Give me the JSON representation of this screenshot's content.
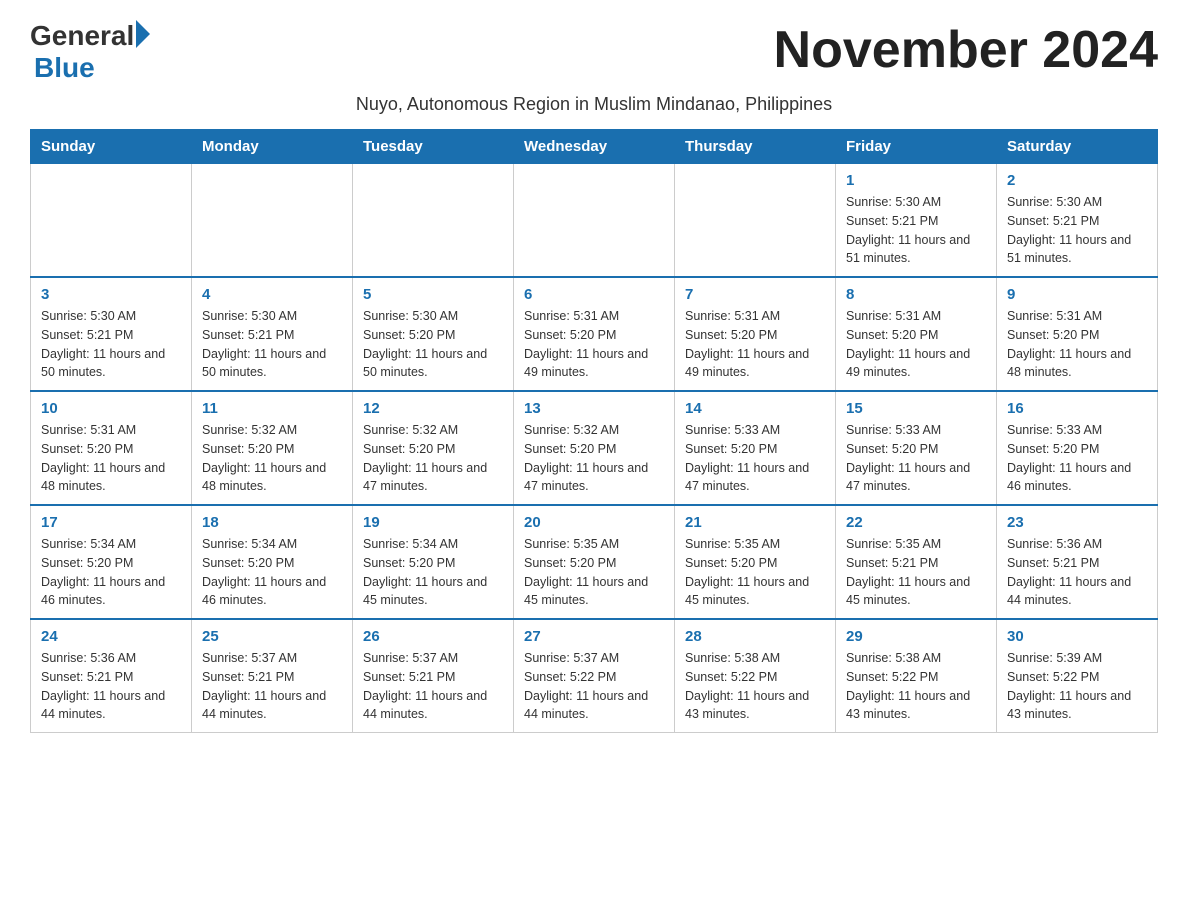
{
  "logo": {
    "general": "General",
    "blue": "Blue"
  },
  "title": "November 2024",
  "subtitle": "Nuyo, Autonomous Region in Muslim Mindanao, Philippines",
  "headers": [
    "Sunday",
    "Monday",
    "Tuesday",
    "Wednesday",
    "Thursday",
    "Friday",
    "Saturday"
  ],
  "weeks": [
    [
      {
        "day": "",
        "info": ""
      },
      {
        "day": "",
        "info": ""
      },
      {
        "day": "",
        "info": ""
      },
      {
        "day": "",
        "info": ""
      },
      {
        "day": "",
        "info": ""
      },
      {
        "day": "1",
        "info": "Sunrise: 5:30 AM\nSunset: 5:21 PM\nDaylight: 11 hours and 51 minutes."
      },
      {
        "day": "2",
        "info": "Sunrise: 5:30 AM\nSunset: 5:21 PM\nDaylight: 11 hours and 51 minutes."
      }
    ],
    [
      {
        "day": "3",
        "info": "Sunrise: 5:30 AM\nSunset: 5:21 PM\nDaylight: 11 hours and 50 minutes."
      },
      {
        "day": "4",
        "info": "Sunrise: 5:30 AM\nSunset: 5:21 PM\nDaylight: 11 hours and 50 minutes."
      },
      {
        "day": "5",
        "info": "Sunrise: 5:30 AM\nSunset: 5:20 PM\nDaylight: 11 hours and 50 minutes."
      },
      {
        "day": "6",
        "info": "Sunrise: 5:31 AM\nSunset: 5:20 PM\nDaylight: 11 hours and 49 minutes."
      },
      {
        "day": "7",
        "info": "Sunrise: 5:31 AM\nSunset: 5:20 PM\nDaylight: 11 hours and 49 minutes."
      },
      {
        "day": "8",
        "info": "Sunrise: 5:31 AM\nSunset: 5:20 PM\nDaylight: 11 hours and 49 minutes."
      },
      {
        "day": "9",
        "info": "Sunrise: 5:31 AM\nSunset: 5:20 PM\nDaylight: 11 hours and 48 minutes."
      }
    ],
    [
      {
        "day": "10",
        "info": "Sunrise: 5:31 AM\nSunset: 5:20 PM\nDaylight: 11 hours and 48 minutes."
      },
      {
        "day": "11",
        "info": "Sunrise: 5:32 AM\nSunset: 5:20 PM\nDaylight: 11 hours and 48 minutes."
      },
      {
        "day": "12",
        "info": "Sunrise: 5:32 AM\nSunset: 5:20 PM\nDaylight: 11 hours and 47 minutes."
      },
      {
        "day": "13",
        "info": "Sunrise: 5:32 AM\nSunset: 5:20 PM\nDaylight: 11 hours and 47 minutes."
      },
      {
        "day": "14",
        "info": "Sunrise: 5:33 AM\nSunset: 5:20 PM\nDaylight: 11 hours and 47 minutes."
      },
      {
        "day": "15",
        "info": "Sunrise: 5:33 AM\nSunset: 5:20 PM\nDaylight: 11 hours and 47 minutes."
      },
      {
        "day": "16",
        "info": "Sunrise: 5:33 AM\nSunset: 5:20 PM\nDaylight: 11 hours and 46 minutes."
      }
    ],
    [
      {
        "day": "17",
        "info": "Sunrise: 5:34 AM\nSunset: 5:20 PM\nDaylight: 11 hours and 46 minutes."
      },
      {
        "day": "18",
        "info": "Sunrise: 5:34 AM\nSunset: 5:20 PM\nDaylight: 11 hours and 46 minutes."
      },
      {
        "day": "19",
        "info": "Sunrise: 5:34 AM\nSunset: 5:20 PM\nDaylight: 11 hours and 45 minutes."
      },
      {
        "day": "20",
        "info": "Sunrise: 5:35 AM\nSunset: 5:20 PM\nDaylight: 11 hours and 45 minutes."
      },
      {
        "day": "21",
        "info": "Sunrise: 5:35 AM\nSunset: 5:20 PM\nDaylight: 11 hours and 45 minutes."
      },
      {
        "day": "22",
        "info": "Sunrise: 5:35 AM\nSunset: 5:21 PM\nDaylight: 11 hours and 45 minutes."
      },
      {
        "day": "23",
        "info": "Sunrise: 5:36 AM\nSunset: 5:21 PM\nDaylight: 11 hours and 44 minutes."
      }
    ],
    [
      {
        "day": "24",
        "info": "Sunrise: 5:36 AM\nSunset: 5:21 PM\nDaylight: 11 hours and 44 minutes."
      },
      {
        "day": "25",
        "info": "Sunrise: 5:37 AM\nSunset: 5:21 PM\nDaylight: 11 hours and 44 minutes."
      },
      {
        "day": "26",
        "info": "Sunrise: 5:37 AM\nSunset: 5:21 PM\nDaylight: 11 hours and 44 minutes."
      },
      {
        "day": "27",
        "info": "Sunrise: 5:37 AM\nSunset: 5:22 PM\nDaylight: 11 hours and 44 minutes."
      },
      {
        "day": "28",
        "info": "Sunrise: 5:38 AM\nSunset: 5:22 PM\nDaylight: 11 hours and 43 minutes."
      },
      {
        "day": "29",
        "info": "Sunrise: 5:38 AM\nSunset: 5:22 PM\nDaylight: 11 hours and 43 minutes."
      },
      {
        "day": "30",
        "info": "Sunrise: 5:39 AM\nSunset: 5:22 PM\nDaylight: 11 hours and 43 minutes."
      }
    ]
  ]
}
